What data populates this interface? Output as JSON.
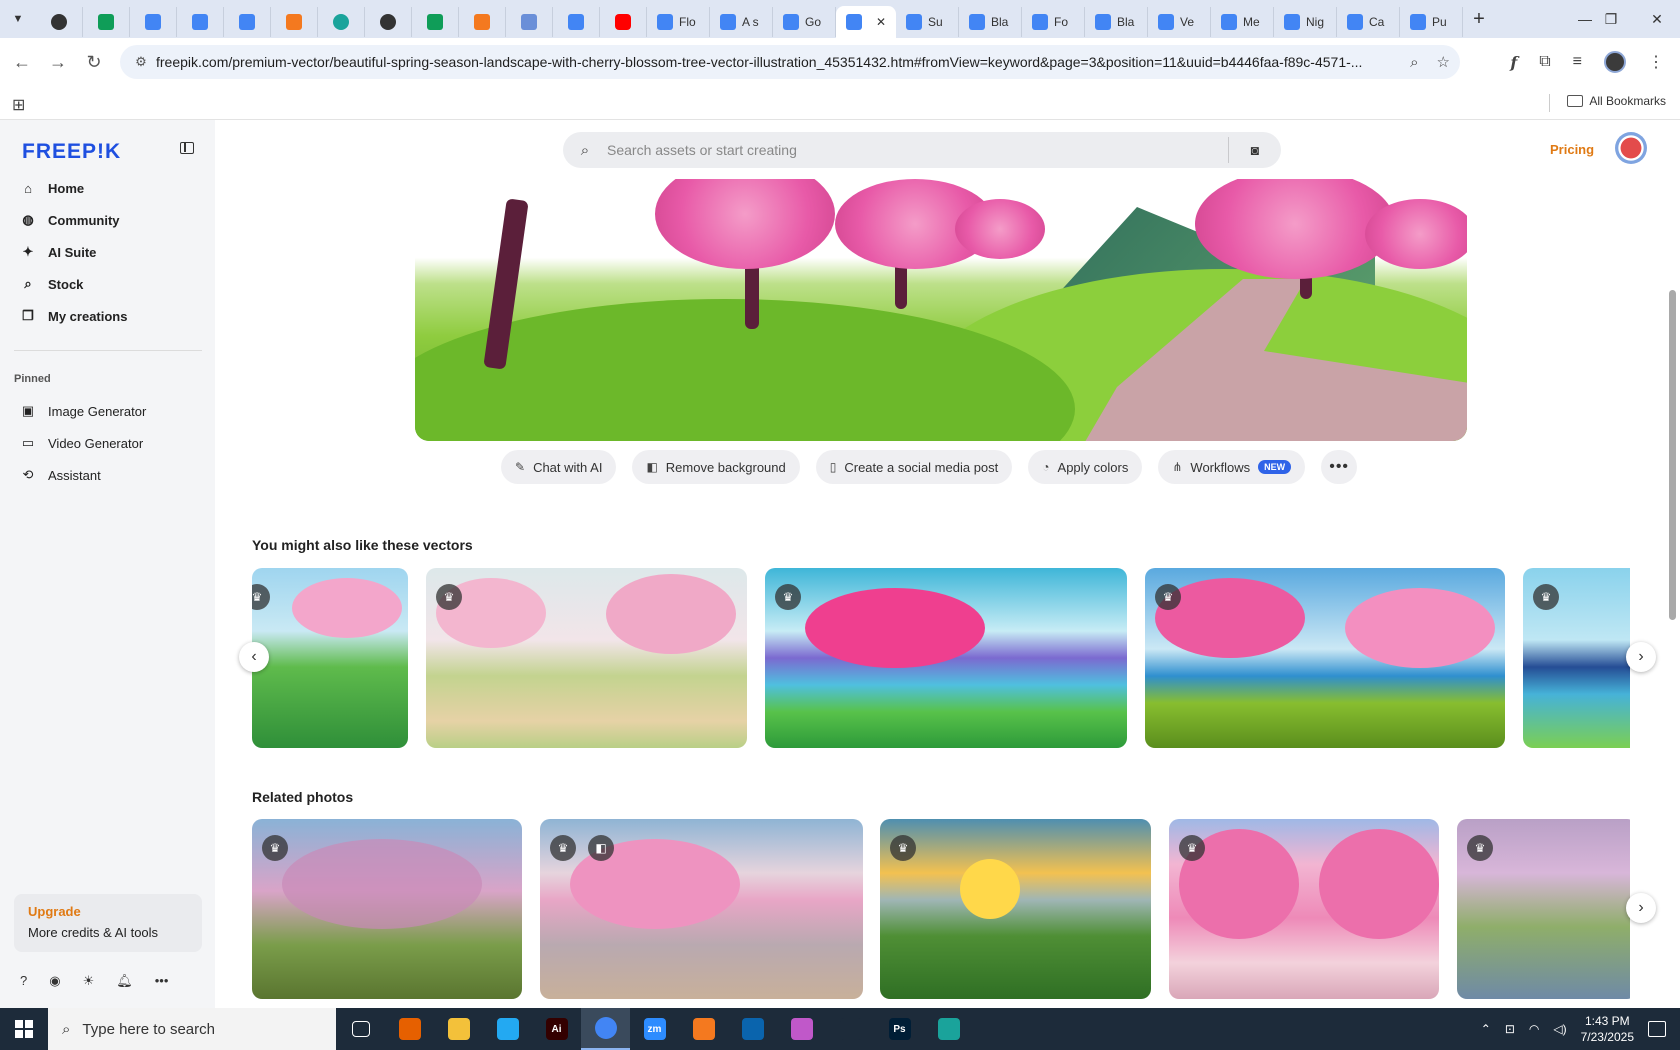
{
  "browser": {
    "tabs": [
      {
        "label": "",
        "favicon": "wordpress-icon",
        "kind": "small"
      },
      {
        "label": "",
        "favicon": "sheets-icon",
        "kind": "small"
      },
      {
        "label": "",
        "favicon": "docs-icon",
        "kind": "small"
      },
      {
        "label": "",
        "favicon": "docs-icon",
        "kind": "small"
      },
      {
        "label": "",
        "favicon": "docs-icon",
        "kind": "small"
      },
      {
        "label": "",
        "favicon": "orange-app-icon",
        "kind": "small"
      },
      {
        "label": "",
        "favicon": "teal-app-icon",
        "kind": "small"
      },
      {
        "label": "",
        "favicon": "openai-icon",
        "kind": "small"
      },
      {
        "label": "",
        "favicon": "sheets-icon",
        "kind": "small"
      },
      {
        "label": "",
        "favicon": "hand-icon",
        "kind": "small"
      },
      {
        "label": "",
        "favicon": "calculator-icon",
        "kind": "small"
      },
      {
        "label": "",
        "favicon": "docs-icon",
        "kind": "small"
      },
      {
        "label": "",
        "favicon": "youtube-icon",
        "kind": "small"
      },
      {
        "label": "Flo",
        "favicon": "docs-icon",
        "kind": "medium"
      },
      {
        "label": "A s",
        "favicon": "docs-icon",
        "kind": "medium"
      },
      {
        "label": "Go",
        "favicon": "docs-icon",
        "kind": "medium"
      },
      {
        "label": "",
        "favicon": "docs-icon",
        "kind": "active"
      },
      {
        "label": "Su",
        "favicon": "docs-icon",
        "kind": "medium"
      },
      {
        "label": "Bla",
        "favicon": "docs-icon",
        "kind": "medium"
      },
      {
        "label": "Fo",
        "favicon": "docs-icon",
        "kind": "medium"
      },
      {
        "label": "Bla",
        "favicon": "docs-icon",
        "kind": "medium"
      },
      {
        "label": "Ve",
        "favicon": "docs-icon",
        "kind": "medium"
      },
      {
        "label": "Me",
        "favicon": "docs-icon",
        "kind": "medium"
      },
      {
        "label": "Nig",
        "favicon": "docs-icon",
        "kind": "medium"
      },
      {
        "label": "Ca",
        "favicon": "docs-icon",
        "kind": "medium"
      },
      {
        "label": "Pu",
        "favicon": "docs-icon",
        "kind": "medium"
      }
    ],
    "url": "freepik.com/premium-vector/beautiful-spring-season-landscape-with-cherry-blossom-tree-vector-illustration_45351432.htm#fromView=keyword&page=3&position=11&uuid=b4446faa-f89c-4571-...",
    "bookmarks_all": "All Bookmarks"
  },
  "sidebar": {
    "logo": "FREEP!K",
    "nav": [
      {
        "label": "Home",
        "icon": "home-icon",
        "glyph": "⌂"
      },
      {
        "label": "Community",
        "icon": "globe-icon",
        "glyph": "◍"
      },
      {
        "label": "AI Suite",
        "icon": "sparkle-icon",
        "glyph": "✦"
      },
      {
        "label": "Stock",
        "icon": "search-icon",
        "glyph": "⌕"
      },
      {
        "label": "My creations",
        "icon": "folder-stack-icon",
        "glyph": "❐"
      }
    ],
    "pinned_label": "Pinned",
    "pinned": [
      {
        "label": "Image Generator",
        "icon": "image-icon",
        "glyph": "▣"
      },
      {
        "label": "Video Generator",
        "icon": "video-icon",
        "glyph": "▭"
      },
      {
        "label": "Assistant",
        "icon": "assistant-icon",
        "glyph": "⟲"
      }
    ],
    "upgrade_title": "Upgrade",
    "upgrade_sub": "More credits & AI tools"
  },
  "header": {
    "search_placeholder": "Search assets or start creating",
    "pricing": "Pricing"
  },
  "actions": [
    {
      "label": "Chat with AI",
      "icon": "chat-ai-icon",
      "glyph": "✎"
    },
    {
      "label": "Remove background",
      "icon": "remove-bg-icon",
      "glyph": "◧"
    },
    {
      "label": "Create a social media post",
      "icon": "phone-icon",
      "glyph": "▯"
    },
    {
      "label": "Apply colors",
      "icon": "palette-icon",
      "glyph": "◔"
    },
    {
      "label": "Workflows",
      "icon": "workflow-icon",
      "glyph": "⋔",
      "badge": "NEW"
    }
  ],
  "sections": {
    "vectors_title": "You might also like these vectors",
    "photos_title": "Related photos"
  },
  "taskbar": {
    "search_placeholder": "Type here to search",
    "time": "1:43 PM",
    "date": "7/23/2025",
    "apps": [
      {
        "name": "task-view-icon",
        "label": "",
        "color": "#1d2b3a"
      },
      {
        "name": "firefox-icon",
        "label": "",
        "color": "#e66000"
      },
      {
        "name": "file-explorer-icon",
        "label": "",
        "color": "#f3c13a"
      },
      {
        "name": "vscode-icon",
        "label": "",
        "color": "#23a9f2"
      },
      {
        "name": "illustrator-icon",
        "label": "Ai",
        "color": "#330000"
      },
      {
        "name": "chrome-icon",
        "label": "",
        "color": "#4285f4"
      },
      {
        "name": "zoom-icon",
        "label": "zm",
        "color": "#2d8cff"
      },
      {
        "name": "orange-app-icon",
        "label": "",
        "color": "#f4791f"
      },
      {
        "name": "outlook-icon",
        "label": "",
        "color": "#0a64ad"
      },
      {
        "name": "color-app-icon",
        "label": "",
        "color": "#c058c9"
      },
      {
        "name": "pen-icon",
        "label": "",
        "color": "#1d2b3a"
      },
      {
        "name": "photoshop-icon",
        "label": "Ps",
        "color": "#001e36"
      },
      {
        "name": "teal-app-icon",
        "label": "",
        "color": "#1aa39b"
      }
    ]
  }
}
